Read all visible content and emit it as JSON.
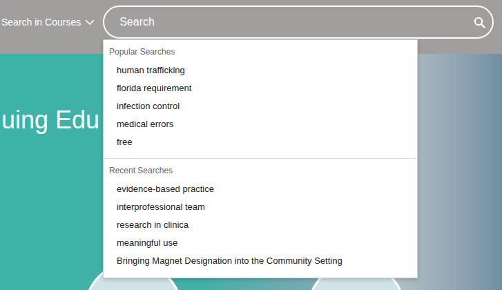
{
  "header": {
    "scope_label": "Search in Courses",
    "scope_expanded": false,
    "search": {
      "placeholder": "Search"
    }
  },
  "hero": {
    "title": "uing Edu"
  },
  "dropdown": {
    "sections": [
      {
        "title": "Popular Searches",
        "items": [
          "human trafficking",
          "florida requirement",
          "infection control",
          "medical errors",
          "free"
        ]
      },
      {
        "title": "Recent Searches",
        "items": [
          "evidence-based practice",
          "interprofessional team",
          "research in clinica",
          "meaningful use",
          "Bringing Magnet Designation into the Community Setting"
        ]
      }
    ]
  }
}
